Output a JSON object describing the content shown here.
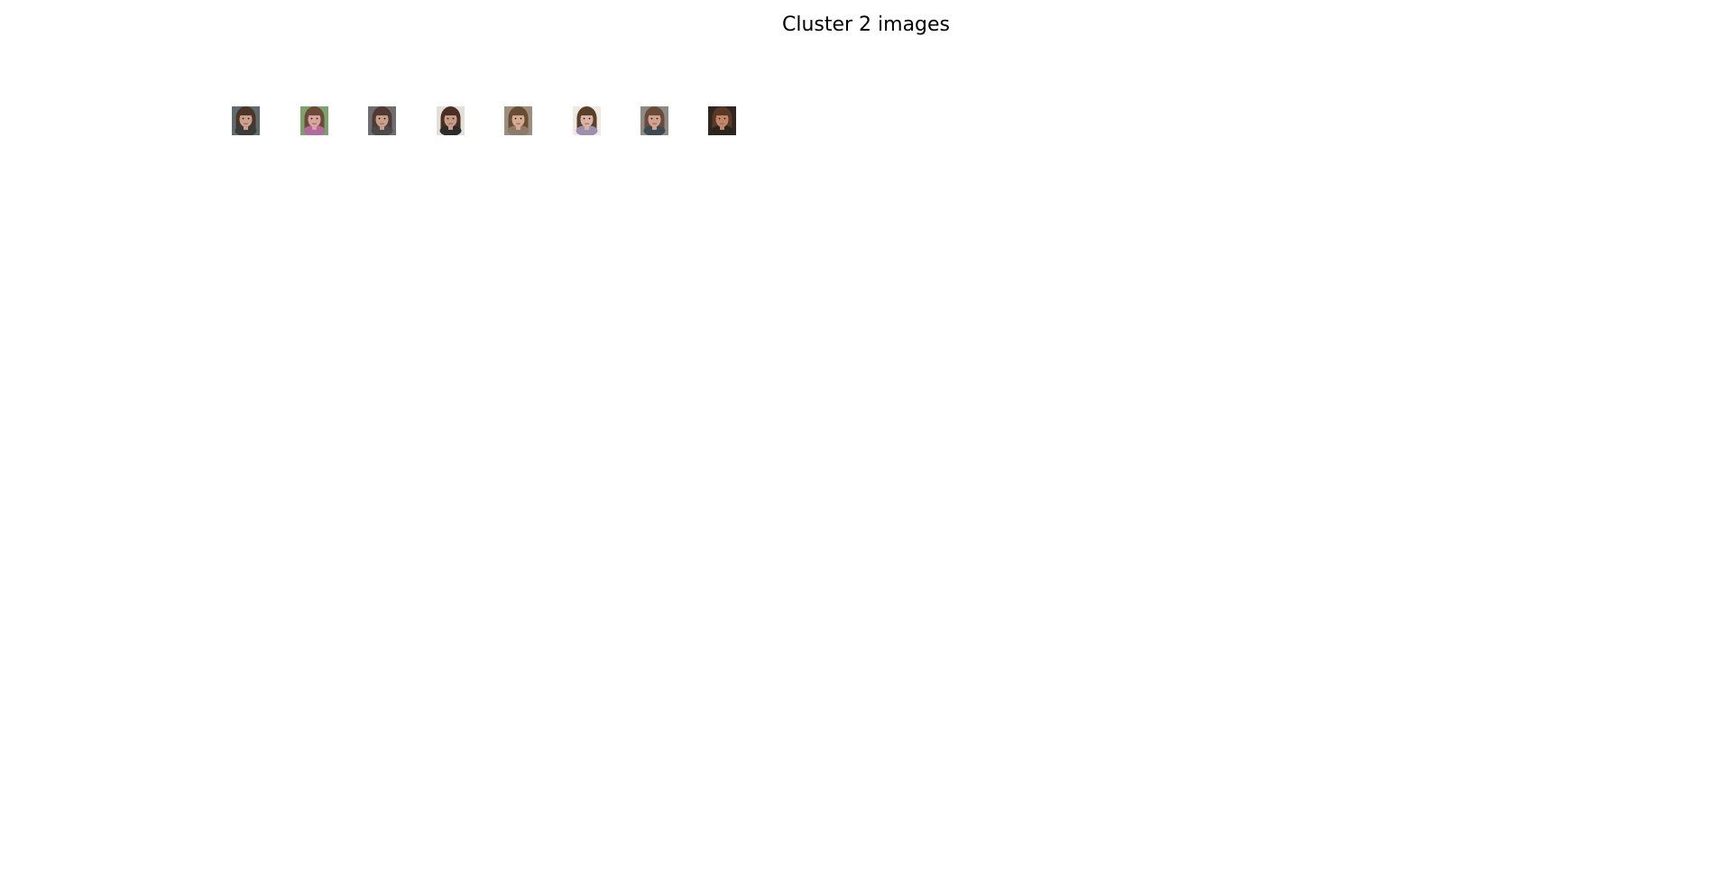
{
  "figure": {
    "title": "Cluster 2 images"
  },
  "thumbnails": [
    {
      "name": "face-thumbnail-1",
      "bg": "#5f6a6e",
      "hair": "#4a3527",
      "skin": "#c9a08e",
      "shirt": "#3b3b3b"
    },
    {
      "name": "face-thumbnail-2",
      "bg": "#7aa36a",
      "hair": "#6b4a3a",
      "skin": "#d7a59c",
      "shirt": "#b06a9c"
    },
    {
      "name": "face-thumbnail-3",
      "bg": "#6e6e72",
      "hair": "#4e3a30",
      "skin": "#c89e8d",
      "shirt": "#4a4a4a"
    },
    {
      "name": "face-thumbnail-4",
      "bg": "#e2e0d8",
      "hair": "#4a3022",
      "skin": "#c79c86",
      "shirt": "#2c2c2c"
    },
    {
      "name": "face-thumbnail-5",
      "bg": "#9c8f7e",
      "hair": "#6a4c34",
      "skin": "#d4ab92",
      "shirt": "#8d7a6a"
    },
    {
      "name": "face-thumbnail-6",
      "bg": "#efe9e2",
      "hair": "#5a3f2a",
      "skin": "#d8b4a4",
      "shirt": "#9c8fb0"
    },
    {
      "name": "face-thumbnail-7",
      "bg": "#8d8a84",
      "hair": "#6a4a38",
      "skin": "#d0a290",
      "shirt": "#3d4a52"
    },
    {
      "name": "face-thumbnail-8",
      "bg": "#2e2620",
      "hair": "#5a3826",
      "skin": "#c1866a",
      "shirt": "#2a2420"
    }
  ]
}
